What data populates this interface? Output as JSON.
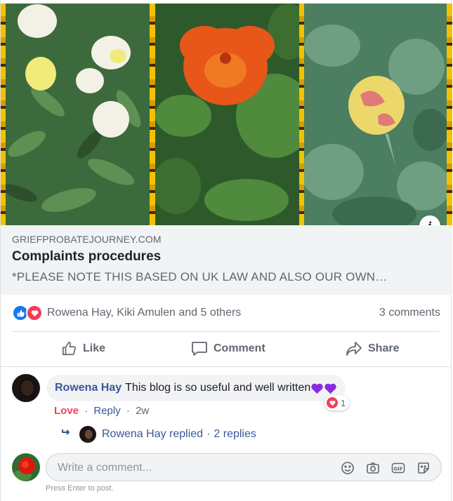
{
  "link_preview": {
    "domain": "GRIEFPROBATEJOURNEY.COM",
    "title": "Complaints procedures",
    "description": "*PLEASE NOTE THIS BASED ON UK LAW AND ALSO OUR OWN…"
  },
  "reactions": {
    "names": "Rowena Hay, Kiki Amulen and 5 others",
    "comments_count": "3 comments"
  },
  "actions": {
    "like": "Like",
    "comment": "Comment",
    "share": "Share"
  },
  "comment": {
    "author": "Rowena Hay",
    "text": "This blog is so useful and well written",
    "reaction_count": "1",
    "love_label": "Love",
    "reply_label": "Reply",
    "time": "2w",
    "separator": "·"
  },
  "replies": {
    "text": "Rowena Hay replied",
    "separator": "·",
    "count": "2 replies"
  },
  "composer": {
    "placeholder": "Write a comment...",
    "hint": "Press Enter to post."
  },
  "info_button": "i",
  "colors": {
    "link_blue": "#385898",
    "like_blue": "#1877f2",
    "love_red": "#f33e58",
    "muted": "#606770"
  }
}
